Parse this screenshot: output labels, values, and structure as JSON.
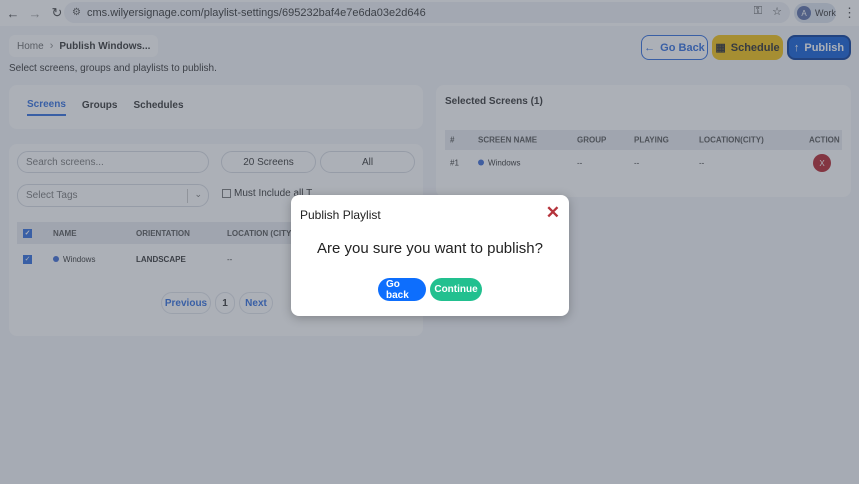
{
  "browser": {
    "url": "cms.wilyersignage.com/playlist-settings/695232baf4e7e6da03e2d646",
    "profile_initial": "A",
    "profile_label": "Work"
  },
  "header": {
    "breadcrumb_home": "Home",
    "breadcrumb_current": "Publish Windows...",
    "subtitle": "Select screens, groups and playlists to publish.",
    "go_back_label": "Go Back",
    "schedule_label": "Schedule",
    "publish_label": "Publish"
  },
  "tabs": [
    {
      "label": "Screens",
      "active": true
    },
    {
      "label": "Groups",
      "active": false
    },
    {
      "label": "Schedules",
      "active": false
    }
  ],
  "filters": {
    "search_placeholder": "Search screens...",
    "count_label": "20 Screens",
    "all_label": "All",
    "tags_placeholder": "Select Tags",
    "must_include_label": "Must Include all T"
  },
  "screens_table": {
    "headers": [
      "NAME",
      "ORIENTATION",
      "LOCATION (CITY)"
    ],
    "rows": [
      {
        "name": "Windows",
        "orientation": "LANDSCAPE",
        "location": "--"
      }
    ]
  },
  "pagination": {
    "previous": "Previous",
    "page": "1",
    "next": "Next"
  },
  "selected": {
    "title": "Selected Screens (1)",
    "headers": [
      "#",
      "SCREEN NAME",
      "GROUP",
      "PLAYING",
      "LOCATION(CITY)",
      "ACTION"
    ],
    "rows": [
      {
        "index": "#1",
        "name": "Windows",
        "group": "--",
        "playing": "--",
        "location": "--",
        "action": "X"
      }
    ]
  },
  "modal": {
    "title": "Publish Playlist",
    "question": "Are you sure you want to publish?",
    "go_back_label": "Go back",
    "continue_label": "Continue"
  },
  "colors": {
    "primary": "#0d6efd",
    "schedule": "#f4c20d",
    "continue": "#22c08f",
    "danger": "#b5222a"
  }
}
